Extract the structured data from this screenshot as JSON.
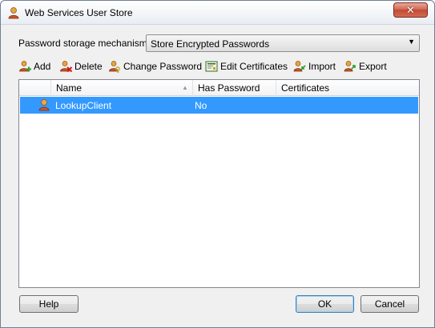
{
  "window": {
    "title": "Web Services User Store",
    "close_label": "✕"
  },
  "password": {
    "label": "Password storage mechanism",
    "selected": "Store Encrypted Passwords"
  },
  "toolbar": {
    "add": "Add",
    "delete": "Delete",
    "change_password": "Change Password",
    "edit_certificates": "Edit Certificates",
    "import": "Import",
    "export": "Export"
  },
  "table": {
    "columns": [
      "Name",
      "Has Password",
      "Certificates"
    ],
    "rows": [
      {
        "name": "LookupClient",
        "has_password": "No",
        "certificates": ""
      }
    ]
  },
  "buttons": {
    "help": "Help",
    "ok": "OK",
    "cancel": "Cancel"
  }
}
